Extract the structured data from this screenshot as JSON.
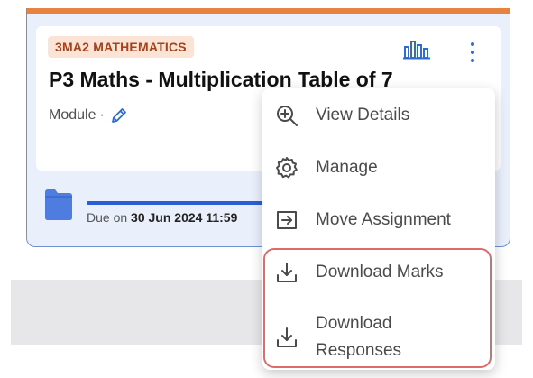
{
  "card": {
    "subject_badge": "3MA2 MATHEMATICS",
    "title": "P3 Maths - Multiplication Table of 7",
    "type_label": "Module",
    "type_separator": "·",
    "due_prefix": "Due on ",
    "due_date": "30 Jun 2024 11:59",
    "progress": 1.0,
    "colors": {
      "accent": "#e8833f",
      "badge_bg": "#fbe4d6",
      "badge_text": "#a4421a",
      "primary": "#2b5ed6"
    },
    "icons": {
      "stats": "bar-chart-icon",
      "more": "more-vertical-icon",
      "edit": "pencil-icon",
      "folder": "folder-icon"
    }
  },
  "menu": {
    "items": [
      {
        "label": "View Details",
        "icon": "zoom-in-icon"
      },
      {
        "label": "Manage",
        "icon": "gear-icon"
      },
      {
        "label": "Move Assignment",
        "icon": "move-icon"
      },
      {
        "label": "Download Marks",
        "icon": "download-icon"
      },
      {
        "label_line1": "Download",
        "label_line2": "Responses",
        "icon": "download-icon"
      }
    ],
    "highlight_color": "#df6a6a"
  }
}
